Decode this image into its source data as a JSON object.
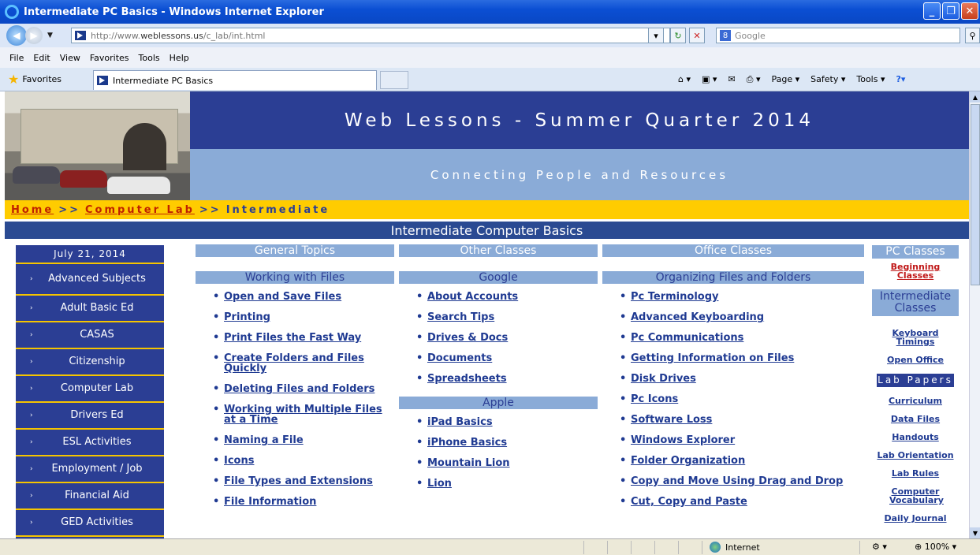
{
  "window": {
    "title": "Intermediate PC Basics - Windows Internet Explorer"
  },
  "address": {
    "url_prefix": "http://www.",
    "url_domain": "weblessons.us",
    "url_path": "/c_lab/int.html",
    "search_placeholder": "Google"
  },
  "menu": [
    "File",
    "Edit",
    "View",
    "Favorites",
    "Tools",
    "Help"
  ],
  "favbar": {
    "favorites": "Favorites",
    "tab_title": "Intermediate PC Basics",
    "commands": [
      "Page ▾",
      "Safety ▾",
      "Tools ▾"
    ]
  },
  "header": {
    "title": "Web Lessons - Summer Quarter 2014",
    "tagline": "Connecting People and Resources"
  },
  "breadcrumb": {
    "home": "Home",
    "sep1": ">>",
    "lab": "Computer Lab",
    "sep2": ">>",
    "current": "Intermediate"
  },
  "banner": "Intermediate Computer Basics",
  "leftnav": {
    "date": "July 21, 2014",
    "bullet": "›",
    "items": [
      "Advanced Subjects",
      "Adult Basic Ed",
      "CASAS",
      "Citizenship",
      "Computer Lab",
      "Drivers Ed",
      "ESL Activities",
      "Employment / Job",
      "Financial Aid",
      "GED Activities"
    ]
  },
  "col1": {
    "head": "General Topics",
    "sub": "Working with Files",
    "links": [
      "Open and Save Files",
      "Printing",
      "Print Files the Fast Way",
      "Create Folders and Files Quickly",
      "Deleting Files and Folders",
      "Working with Multiple Files at a Time",
      "Naming a File",
      "Icons",
      "File Types and Extensions",
      "File Information"
    ]
  },
  "col2": {
    "head": "Other Classes",
    "sub": "Google",
    "links": [
      "About Accounts",
      "Search Tips",
      "Drives & Docs",
      "Documents",
      "Spreadsheets"
    ],
    "sub2": "Apple",
    "links2": [
      "iPad Basics",
      "iPhone Basics",
      "Mountain Lion",
      "Lion"
    ]
  },
  "col3": {
    "head": "Office Classes",
    "sub": "Organizing Files and Folders",
    "links": [
      "Pc Terminology",
      "Advanced Keyboarding",
      "Pc Communications",
      "Getting Information on Files",
      "Disk Drives",
      "Pc Icons",
      "Software Loss",
      "Windows Explorer",
      "Folder Organization",
      "Copy and Move Using Drag and Drop",
      "Cut, Copy and Paste"
    ]
  },
  "right": {
    "head": "PC Classes",
    "beginning": "Beginning Classes",
    "intermediate": "Intermediate Classes",
    "keyboard": "Keyboard Timings",
    "openoffice": "Open Office",
    "labpapers": "Lab Papers",
    "links": [
      "Curriculum",
      "Data Files",
      "Handouts",
      "Lab Orientation",
      "Lab Rules",
      "Computer Vocabulary",
      "Daily Journal"
    ]
  },
  "status": {
    "zone": "Internet",
    "zoom": "100%"
  }
}
